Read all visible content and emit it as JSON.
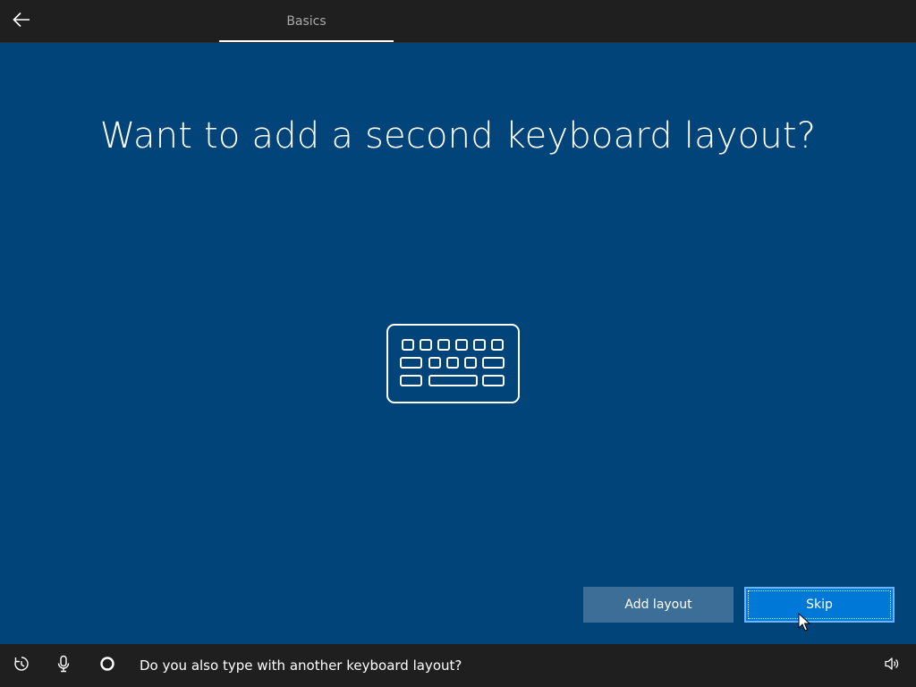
{
  "header": {
    "back_icon": "back-arrow-icon",
    "tabs": [
      {
        "label": "Basics",
        "active": true
      }
    ]
  },
  "main": {
    "title": "Want to add a second keyboard layout?",
    "hero_icon": "keyboard-icon"
  },
  "actions": {
    "add_layout_label": "Add layout",
    "skip_label": "Skip"
  },
  "bottom_bar": {
    "icons": [
      "accessibility-icon",
      "microphone-icon",
      "cortana-icon",
      "volume-icon"
    ],
    "caption": "Do you also type with another keyboard layout?"
  },
  "colors": {
    "background": "#00447a",
    "bar": "#1f1f1f",
    "primary_button": "#0078d7",
    "secondary_button": "#3c6e98"
  }
}
